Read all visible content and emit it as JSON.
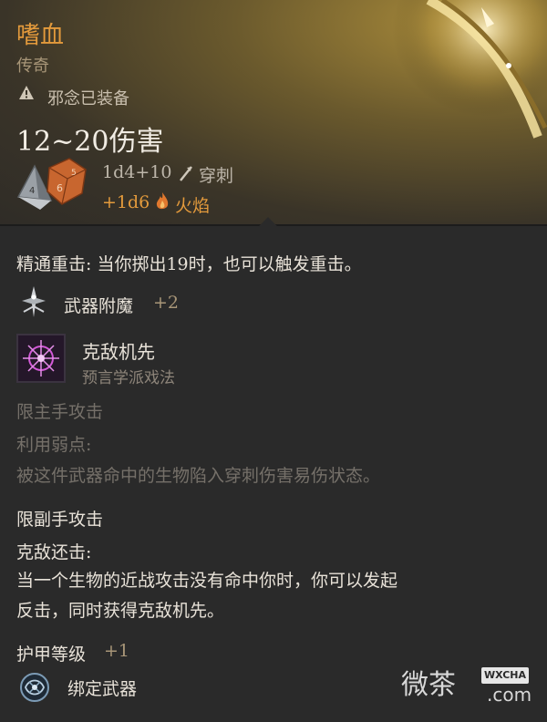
{
  "item": {
    "name": "嗜血",
    "rarity": "传奇",
    "warning": "邪念已装备",
    "damage": "12~20伤害",
    "roll": "1d4+10",
    "damage_type": "穿刺",
    "bonus_roll": "+1d6",
    "bonus_type": "火焰"
  },
  "mastery": "精通重击: 当你掷出19时，也可以触发重击。",
  "enchant": {
    "label": "武器附魔",
    "bonus": "+2"
  },
  "spell": {
    "name": "克敌机先",
    "school": "预言学派戏法"
  },
  "mainhand": {
    "label": "限主手攻击",
    "feature": "利用弱点:",
    "description": "被这件武器命中的生物陷入穿刺伤害易伤状态。"
  },
  "offhand": {
    "label": "限副手攻击",
    "feature": "克敌还击:",
    "description_line1": "当一个生物的近战攻击没有命中你时，你可以发起",
    "description_line2": "反击，同时获得克敌机先。"
  },
  "armor": {
    "label": "护甲等级",
    "bonus": "+1"
  },
  "bound": "绑定武器",
  "watermark": {
    "text": "微茶",
    "badge": "WXCHA",
    "suffix": ".com"
  },
  "icons": {
    "warning": "warning-triangle-icon",
    "dice": "dice-icon",
    "pierce": "pierce-icon",
    "fire": "fire-icon",
    "enchant": "weapon-enchant-icon",
    "spell": "true-strike-icon",
    "bind": "bind-weapon-icon"
  },
  "colors": {
    "accent_orange": "#e39a3c",
    "muted_gold": "#a89678",
    "text": "#e8e2d8",
    "dim": "#757069"
  }
}
